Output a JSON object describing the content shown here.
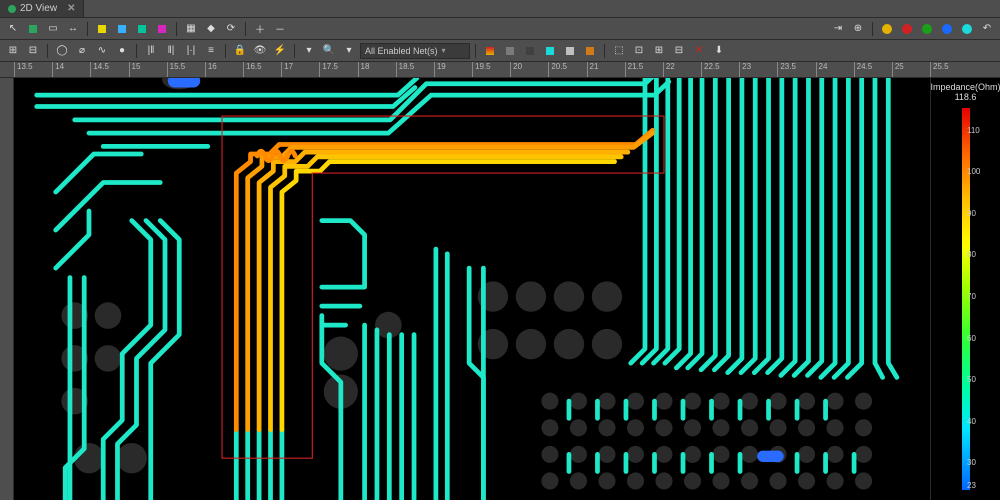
{
  "tab": {
    "title": "2D View",
    "close": "✕"
  },
  "toolbar": {
    "net_filter": "All Enabled Net(s)"
  },
  "ruler": {
    "ticks": [
      "13.5",
      "14",
      "14.5",
      "15",
      "15.5",
      "16",
      "16.5",
      "17",
      "17.5",
      "18",
      "18.5",
      "19",
      "19.5",
      "20",
      "20.5",
      "21",
      "21.5",
      "22",
      "22.5",
      "23",
      "23.5",
      "24",
      "24.5",
      "25",
      "25.5"
    ]
  },
  "legend": {
    "title": "Impedance(Ohm)",
    "max": "118.6",
    "ticks": [
      {
        "v": "110",
        "p": 6
      },
      {
        "v": "100",
        "p": 17
      },
      {
        "v": "90",
        "p": 28
      },
      {
        "v": "80",
        "p": 39
      },
      {
        "v": "70",
        "p": 50
      },
      {
        "v": "60",
        "p": 61
      },
      {
        "v": "50",
        "p": 72
      },
      {
        "v": "40",
        "p": 83
      },
      {
        "v": "30",
        "p": 94
      },
      {
        "v": "23",
        "p": 100
      }
    ]
  },
  "colors": {
    "trace_aqua": "#1de8c8",
    "trace_orange": "#ff8a00",
    "trace_yellow": "#d8ff00",
    "pad": "#363636",
    "pad_dark": "#2a2a2a",
    "blue": "#2a6cff",
    "sel": "#d42020"
  }
}
